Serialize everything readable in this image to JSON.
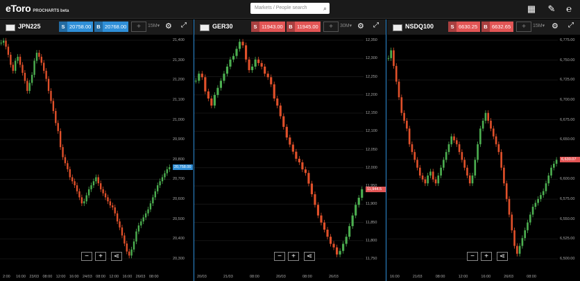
{
  "app": {
    "logo": "eToro",
    "subtitle": "PROCHARTS beta",
    "search_placeholder": "Markets / People search"
  },
  "panels": [
    {
      "symbol": "JPN225",
      "sell_label": "S",
      "sell_price": "20758.00",
      "buy_label": "B",
      "buy_price": "20768.00",
      "price_color": "#2f8fd8",
      "timeframe": "15M",
      "y_ticks": [
        "21,400",
        "21,300",
        "21,200",
        "21,100",
        "21,000",
        "20,900",
        "20,800",
        "20,700",
        "20,600",
        "20,500",
        "20,400",
        "20,300"
      ],
      "current_tag": "20,758.00",
      "x_ticks": [
        "2:00",
        "16:00",
        "23/03",
        "08:00",
        "12:00",
        "16:00",
        "24/03",
        "08:00",
        "12:00",
        "16:00",
        "26/03",
        "08:00"
      ],
      "y_range": [
        20300,
        21430
      ],
      "series": [
        21390,
        21400,
        21370,
        21330,
        21280,
        21250,
        21300,
        21320,
        21280,
        21240,
        21200,
        21150,
        21190,
        21230,
        21300,
        21340,
        21320,
        21290,
        21250,
        21210,
        21150,
        21100,
        21050,
        20990,
        20950,
        20870,
        20820,
        20790,
        20760,
        20720,
        20700,
        20680,
        20650,
        20620,
        20590,
        20600,
        20630,
        20660,
        20680,
        20700,
        20720,
        20690,
        20660,
        20640,
        20620,
        20600,
        20580,
        20570,
        20540,
        20500,
        20470,
        20430,
        20390,
        20350,
        20330,
        20360,
        20400,
        20450,
        20480,
        20500,
        20520,
        20540,
        20560,
        20590,
        20620,
        20650,
        20680,
        20700,
        20720,
        20740,
        20760,
        20770
      ]
    },
    {
      "symbol": "GER30",
      "sell_label": "S",
      "sell_price": "11943.00",
      "buy_label": "B",
      "buy_price": "11945.00",
      "price_color": "#e25555",
      "timeframe": "30M",
      "y_ticks": [
        "12,350",
        "12,300",
        "12,250",
        "12,200",
        "12,150",
        "12,100",
        "12,050",
        "12,000",
        "11,950",
        "11,900",
        "11,850",
        "11,800",
        "11,750"
      ],
      "current_tag": "11,944.5",
      "x_ticks": [
        "20/03",
        "21/03",
        "08:00",
        "20/03",
        "08:00",
        "26/03"
      ],
      "y_range": [
        11740,
        12380
      ],
      "series": [
        12250,
        12270,
        12260,
        12220,
        12200,
        12180,
        12210,
        12230,
        12250,
        12270,
        12290,
        12310,
        12320,
        12340,
        12360,
        12350,
        12310,
        12280,
        12290,
        12310,
        12300,
        12290,
        12270,
        12260,
        12240,
        12200,
        12180,
        12150,
        12120,
        12090,
        12070,
        12050,
        12030,
        12020,
        12000,
        11990,
        11960,
        11930,
        11900,
        11870,
        11850,
        11830,
        11810,
        11790,
        11780,
        11760,
        11770,
        11790,
        11810,
        11840,
        11870,
        11900,
        11920,
        11944
      ]
    },
    {
      "symbol": "NSDQ100",
      "sell_label": "S",
      "sell_price": "6630.25",
      "buy_label": "B",
      "buy_price": "6632.65",
      "price_color": "#e25555",
      "timeframe": "15M",
      "y_ticks": [
        "6,775.00",
        "6,750.00",
        "6,725.00",
        "6,700.00",
        "6,675.00",
        "6,650.00",
        "6,625.00",
        "6,600.00",
        "6,575.00",
        "6,550.00",
        "6,525.00",
        "6,500.00"
      ],
      "current_tag": "6,630.07",
      "x_ticks": [
        "16:00",
        "21/03",
        "08:00",
        "12:00",
        "16:00",
        "26/03",
        "08:00"
      ],
      "y_range": [
        6500,
        6790
      ],
      "series": [
        6760,
        6770,
        6750,
        6730,
        6710,
        6690,
        6680,
        6670,
        6650,
        6640,
        6630,
        6620,
        6610,
        6605,
        6600,
        6610,
        6615,
        6605,
        6600,
        6610,
        6620,
        6630,
        6640,
        6650,
        6660,
        6655,
        6650,
        6640,
        6630,
        6620,
        6610,
        6600,
        6610,
        6630,
        6650,
        6670,
        6680,
        6690,
        6680,
        6670,
        6660,
        6650,
        6640,
        6620,
        6600,
        6580,
        6560,
        6540,
        6520,
        6510,
        6520,
        6530,
        6540,
        6550,
        6560,
        6570,
        6575,
        6580,
        6585,
        6590,
        6600,
        6610,
        6620,
        6625,
        6630
      ]
    }
  ]
}
